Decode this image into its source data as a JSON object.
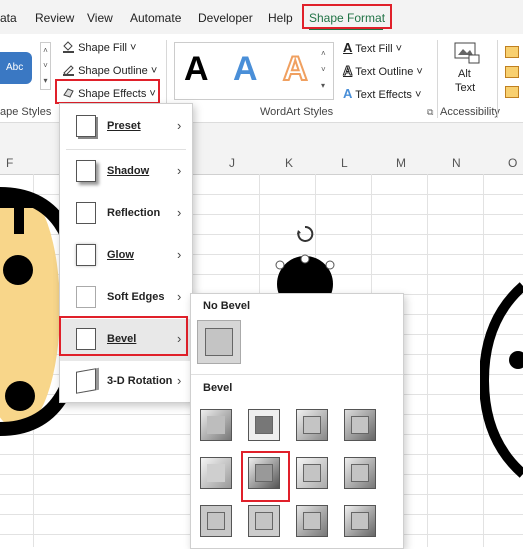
{
  "tabs": [
    {
      "label": "ata"
    },
    {
      "label": "Review"
    },
    {
      "label": "View"
    },
    {
      "label": "Automate"
    },
    {
      "label": "Developer"
    },
    {
      "label": "Help"
    },
    {
      "label": "Shape Format"
    }
  ],
  "ribbon": {
    "style_swatch": "Abc",
    "shape_fill": "Shape Fill",
    "shape_outline": "Shape Outline",
    "shape_effects": "Shape Effects",
    "shape_styles_group": "ape Styles",
    "wordart_letter": "A",
    "wordart_group": "WordArt Styles",
    "text_fill": "Text Fill",
    "text_outline": "Text Outline",
    "text_effects": "Text Effects",
    "alt_text_line1": "Alt",
    "alt_text_line2": "Text",
    "accessibility_group": "Accessibility"
  },
  "columns": [
    "F",
    "J",
    "K",
    "L",
    "M",
    "N",
    "O"
  ],
  "effects_menu": {
    "items": [
      {
        "label": "Preset"
      },
      {
        "label": "Shadow"
      },
      {
        "label": "Reflection"
      },
      {
        "label": "Glow"
      },
      {
        "label": "Soft Edges"
      },
      {
        "label": "Bevel"
      },
      {
        "label": "3-D Rotation"
      }
    ]
  },
  "bevel_gallery": {
    "no_bevel_heading": "No Bevel",
    "bevel_heading": "Bevel"
  },
  "colors": {
    "accent_green": "#217346",
    "highlight_red": "#e0202a",
    "wordart_blue": "#4a8fd8",
    "wordart_orange": "#f0a060"
  }
}
